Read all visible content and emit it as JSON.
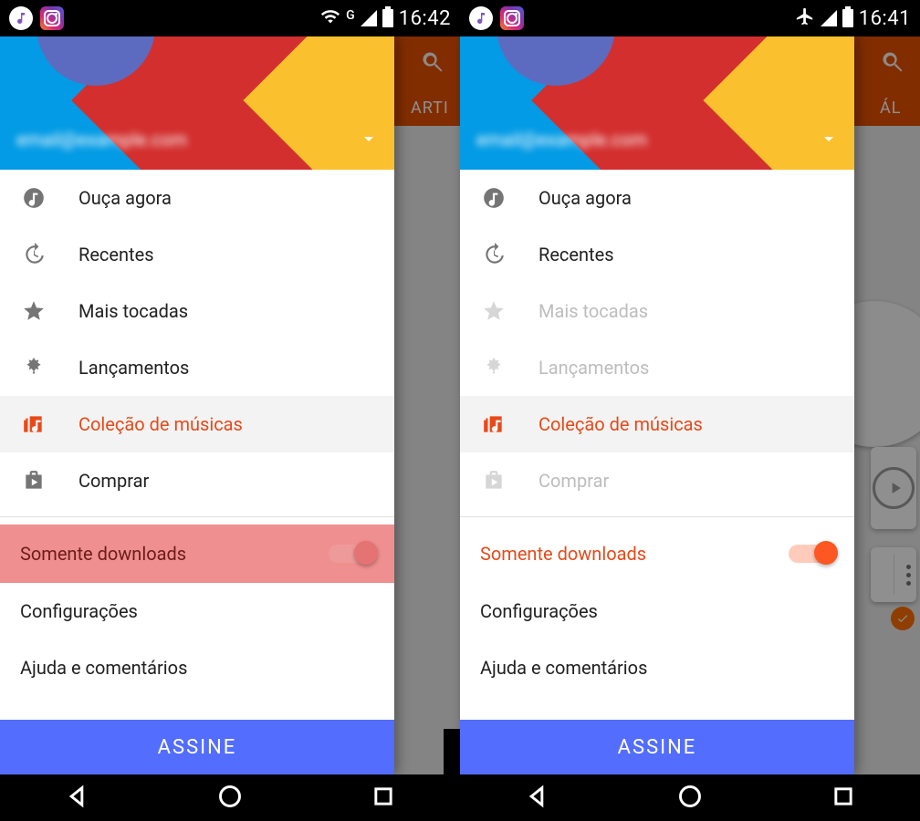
{
  "left": {
    "status": {
      "g_indicator": "G",
      "time": "16:42"
    },
    "underlay_tab": "ARTI",
    "drawer": {
      "email_placeholder": "email@example.com",
      "items": {
        "listen_now": {
          "label": "Ouça agora"
        },
        "recent": {
          "label": "Recentes"
        },
        "top_played": {
          "label": "Mais tocadas"
        },
        "releases": {
          "label": "Lançamentos"
        },
        "library": {
          "label": "Coleção de músicas"
        },
        "buy": {
          "label": "Comprar"
        }
      },
      "downloads_only": {
        "label": "Somente downloads"
      },
      "settings": {
        "label": "Configurações"
      },
      "help": {
        "label": "Ajuda e comentários"
      },
      "subscribe": {
        "label": "ASSINE"
      }
    }
  },
  "right": {
    "status": {
      "time": "16:41"
    },
    "underlay_tab": "ÁL",
    "drawer": {
      "email_placeholder": "email@example.com",
      "items": {
        "listen_now": {
          "label": "Ouça agora"
        },
        "recent": {
          "label": "Recentes"
        },
        "top_played": {
          "label": "Mais tocadas"
        },
        "releases": {
          "label": "Lançamentos"
        },
        "library": {
          "label": "Coleção de músicas"
        },
        "buy": {
          "label": "Comprar"
        }
      },
      "downloads_only": {
        "label": "Somente downloads"
      },
      "settings": {
        "label": "Configurações"
      },
      "help": {
        "label": "Ajuda e comentários"
      },
      "subscribe": {
        "label": "ASSINE"
      }
    }
  }
}
